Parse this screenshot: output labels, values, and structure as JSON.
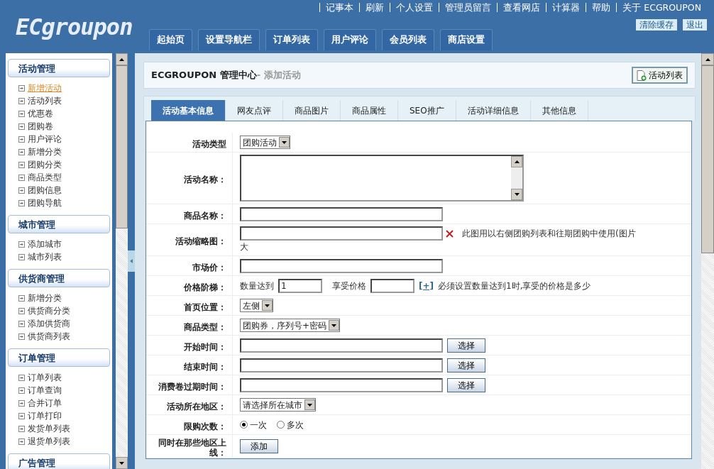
{
  "header": {
    "logo": "ECgroupon",
    "top_links": [
      "记事本",
      "刷新",
      "个人设置",
      "管理员留言",
      "查看网店",
      "计算器",
      "帮助",
      "关于 ECGROUPON"
    ],
    "buttons": [
      "清除缓存",
      "退出"
    ],
    "nav": [
      "起始页",
      "设置导航栏",
      "订单列表",
      "用户评论",
      "会员列表",
      "商店设置"
    ]
  },
  "sidebar": {
    "groups": [
      {
        "title": "活动管理",
        "items": [
          {
            "label": "新增活动",
            "selected": true
          },
          {
            "label": "活动列表",
            "selected": false
          },
          {
            "label": "优惠卷",
            "selected": false
          },
          {
            "label": "团购卷",
            "selected": false
          },
          {
            "label": "用户评论",
            "selected": false
          },
          {
            "label": "新增分类",
            "selected": false
          },
          {
            "label": "团购分类",
            "selected": false
          },
          {
            "label": "商品类型",
            "selected": false
          },
          {
            "label": "团购信息",
            "selected": false
          },
          {
            "label": "团购导航",
            "selected": false
          }
        ]
      },
      {
        "title": "城市管理",
        "items": [
          {
            "label": "添加城市",
            "selected": false
          },
          {
            "label": "城市列表",
            "selected": false
          }
        ]
      },
      {
        "title": "供货商管理",
        "items": [
          {
            "label": "新增分类",
            "selected": false
          },
          {
            "label": "供货商分类",
            "selected": false
          },
          {
            "label": "添加供货商",
            "selected": false
          },
          {
            "label": "供货商列表",
            "selected": false
          }
        ]
      },
      {
        "title": "订单管理",
        "items": [
          {
            "label": "订单列表",
            "selected": false
          },
          {
            "label": "订单查询",
            "selected": false
          },
          {
            "label": "合并订单",
            "selected": false
          },
          {
            "label": "订单打印",
            "selected": false
          },
          {
            "label": "发货单列表",
            "selected": false
          },
          {
            "label": "退货单列表",
            "selected": false
          }
        ]
      },
      {
        "title": "广告管理"
      }
    ]
  },
  "page": {
    "title": "ECGROUPON 管理中心",
    "subtitle": "- 添加活动",
    "action": "活动列表"
  },
  "tabs": [
    {
      "label": "活动基本信息",
      "selected": true
    },
    {
      "label": "网友点评",
      "selected": false
    },
    {
      "label": "商品图片",
      "selected": false
    },
    {
      "label": "商品属性",
      "selected": false
    },
    {
      "label": "SEO推广",
      "selected": false
    },
    {
      "label": "活动详细信息",
      "selected": false
    },
    {
      "label": "其他信息",
      "selected": false
    }
  ],
  "form": {
    "rows": [
      {
        "label": "活动类型",
        "kind": "select",
        "value": "团购活动"
      },
      {
        "label": "活动名称：",
        "kind": "textarea"
      },
      {
        "label": "商品名称：",
        "kind": "input"
      },
      {
        "label": "活动缩略图：",
        "kind": "file",
        "hint": "此图用以右侧团购列表和往期团购中使用(图片",
        "hint_2": "大"
      },
      {
        "label": "市场价：",
        "kind": "input"
      },
      {
        "label": "价格阶梯：",
        "kind": "ladder",
        "prefix": "数量达到",
        "value": "1",
        "middle": "享受价格",
        "link": "[+]",
        "hint": "必须设置数量达到1时,享受的价格是多少"
      },
      {
        "label": "首页位置：",
        "kind": "select",
        "value": "左侧"
      },
      {
        "label": "商品类型：",
        "kind": "select",
        "value": "团购券，序列号+密码"
      },
      {
        "label": "开始时间：",
        "kind": "date",
        "button": "选择"
      },
      {
        "label": "结束时间：",
        "kind": "date",
        "button": "选择"
      },
      {
        "label": "消费卷过期时间：",
        "kind": "date",
        "button": "选择"
      },
      {
        "label": "活动所在地区：",
        "kind": "select",
        "value": "请选择所在城市"
      },
      {
        "label": "限购次数：",
        "kind": "radio",
        "options": [
          {
            "label": "一次",
            "selected": true
          },
          {
            "label": "多次",
            "selected": false
          }
        ]
      },
      {
        "label": "同时在那些地区上线：",
        "kind": "add",
        "button": "添加"
      }
    ]
  }
}
